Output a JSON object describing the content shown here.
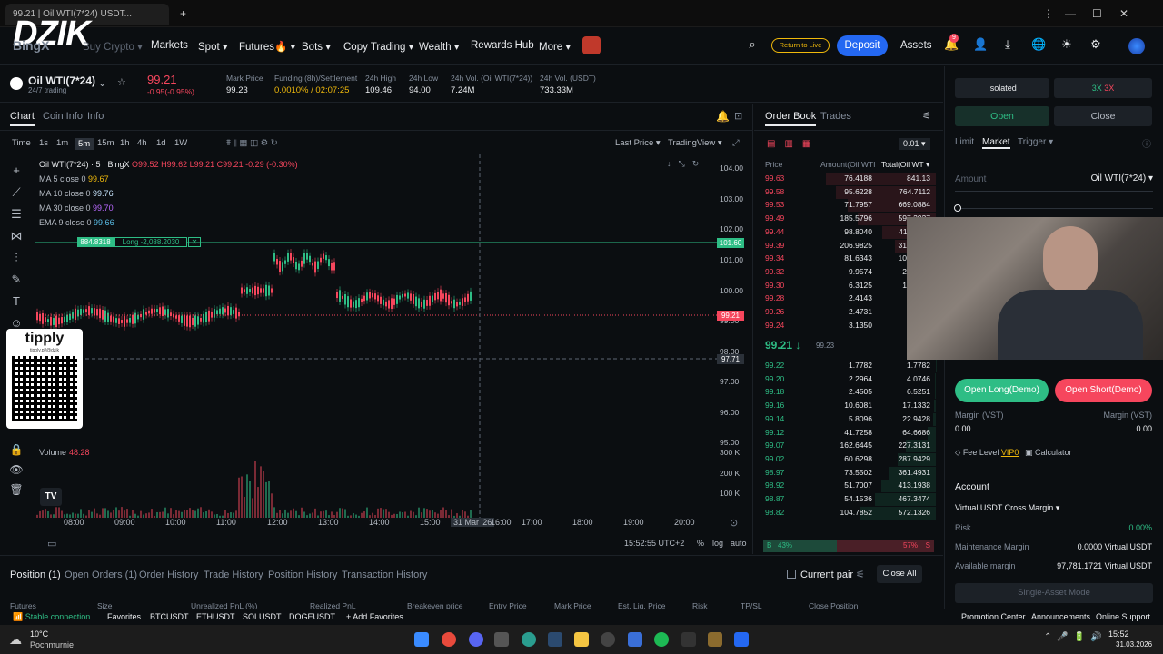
{
  "browser": {
    "tab_title": "99.21 | Oil WTI(7*24) USDT...",
    "new_tab": "+",
    "menu": "⋮",
    "minimize": "—",
    "maximize": "☐",
    "close": "✕"
  },
  "nav": {
    "logo": "DZIK",
    "logo_sub": "BingX",
    "items": [
      "Buy Crypto ▾",
      "Markets",
      "Spot ▾",
      "Futures🔥 ▾",
      "Bots ▾",
      "Copy Trading ▾",
      "Wealth ▾",
      "Rewards Hub",
      "More ▾"
    ],
    "return_live": "Return to Live",
    "deposit": "Deposit",
    "assets": "Assets",
    "notif_count": "9"
  },
  "ticker": {
    "symbol": "Oil WTI(7*24)",
    "sub": "24/7 trading",
    "price": "99.21",
    "change": "-0.95(-0.95%)",
    "stats": [
      {
        "label": "Mark Price",
        "value": "99.23"
      },
      {
        "label": "Funding (8h)/Settlement",
        "value": "0.0010% / 02:07:25"
      },
      {
        "label": "24h High",
        "value": "109.46"
      },
      {
        "label": "24h Low",
        "value": "94.00"
      },
      {
        "label": "24h Vol. (Oil WTI(7*24))",
        "value": "7.24M"
      },
      {
        "label": "24h Vol. (USDT)",
        "value": "733.33M"
      }
    ]
  },
  "chart": {
    "tabs": [
      "Chart",
      "Coin Info",
      "Info"
    ],
    "timeframes": [
      "Time",
      "1s",
      "1m",
      "5m",
      "15m",
      "1h",
      "4h",
      "1d",
      "1W"
    ],
    "price_mode": "Last Price ▾",
    "view_mode": "TradingView ▾",
    "legend_title": "Oil WTI(7*24) · 5 · BingX",
    "legend_ohlc": "O99.52 H99.62 L99.21 C99.21 -0.29 (-0.30%)",
    "ma": [
      {
        "name": "MA 5 close 0",
        "value": "99.67",
        "color": "#f0b90b"
      },
      {
        "name": "MA 10 close 0",
        "value": "99.76",
        "color": "#c8e6ff"
      },
      {
        "name": "MA 30 close 0",
        "value": "99.70",
        "color": "#b968ff"
      },
      {
        "name": "EMA 9 close 0",
        "value": "99.66",
        "color": "#5bc0eb"
      }
    ],
    "position_tag_price": "884.8318",
    "position_tag_label": "Long -2,088.2030",
    "y_ticks": [
      "104.00",
      "103.00",
      "102.00",
      "101.00",
      "100.00",
      "99.00",
      "98.00",
      "97.00",
      "96.00",
      "95.00"
    ],
    "price_tag": "99.21",
    "entry_tag": "101.60",
    "cursor_tag": "97.71",
    "volume_label": "Volume",
    "volume_value": "48.28",
    "vol_ticks": [
      "300 K",
      "200 K",
      "100 K"
    ],
    "x_ticks": [
      "08:00",
      "09:00",
      "10:00",
      "11:00",
      "12:00",
      "13:00",
      "14:00",
      "15:00",
      "31 Mar '26",
      "16:00",
      "17:00",
      "18:00",
      "19:00",
      "20:00"
    ],
    "clock": "15:52:55 UTC+2",
    "pct": "%",
    "log": "log",
    "auto": "auto",
    "tippy_label": "tipply",
    "tippy_url": "tipply.pl/@dzik"
  },
  "orderbook": {
    "tabs": [
      "Order Book",
      "Trades"
    ],
    "precision": "0.01 ▾",
    "headers": [
      "Price",
      "Amount(Oil WTI",
      "Total(Oil WT ▾"
    ],
    "asks": [
      [
        "99.63",
        "76.4188",
        "841.13"
      ],
      [
        "99.58",
        "95.6228",
        "764.7112"
      ],
      [
        "99.53",
        "71.7957",
        "669.0884"
      ],
      [
        "99.49",
        "185.5796",
        "597.2927"
      ],
      [
        "99.44",
        "98.8040",
        "411.7131"
      ],
      [
        "99.39",
        "206.9825",
        "312.9091"
      ],
      [
        "99.34",
        "81.6343",
        "105.9266"
      ],
      [
        "99.32",
        "9.9574",
        "24.2923"
      ],
      [
        "99.30",
        "6.3125",
        "14.3349"
      ],
      [
        "99.28",
        "2.4143",
        "8.0224"
      ],
      [
        "99.26",
        "2.4731",
        "5.6081"
      ],
      [
        "99.24",
        "3.1350",
        "3.1350"
      ]
    ],
    "mid_price": "99.21 ↓",
    "mid_mark": "99.23",
    "bids": [
      [
        "99.22",
        "1.7782",
        "1.7782"
      ],
      [
        "99.20",
        "2.2964",
        "4.0746"
      ],
      [
        "99.18",
        "2.4505",
        "6.5251"
      ],
      [
        "99.16",
        "10.6081",
        "17.1332"
      ],
      [
        "99.14",
        "5.8096",
        "22.9428"
      ],
      [
        "99.12",
        "41.7258",
        "64.6686"
      ],
      [
        "99.07",
        "162.6445",
        "227.3131"
      ],
      [
        "99.02",
        "60.6298",
        "287.9429"
      ],
      [
        "98.97",
        "73.5502",
        "361.4931"
      ],
      [
        "98.92",
        "51.7007",
        "413.1938"
      ],
      [
        "98.87",
        "54.1536",
        "467.3474"
      ],
      [
        "98.82",
        "104.7852",
        "572.1326"
      ]
    ],
    "buy_pct": "43%",
    "sell_pct": "57%",
    "buy_ratio": 0.43,
    "b": "B",
    "s": "S"
  },
  "trade": {
    "margin_mode": "Isolated",
    "leverage_a": "3X",
    "leverage_b": "3X",
    "open": "Open",
    "close": "Close",
    "order_types": [
      "Limit",
      "Market",
      "Trigger ▾"
    ],
    "amount_placeholder": "Amount",
    "amount_unit": "Oil WTI(7*24) ▾",
    "open_long": "Open Long(Demo)",
    "open_short": "Open Short(Demo)",
    "margin_l": "Margin (VST)",
    "margin_r": "Margin (VST)",
    "margin_l_val": "0.00",
    "margin_r_val": "0.00",
    "fee_level": "Fee Level",
    "vip": "VIP0",
    "calculator": "Calculator",
    "account": "Account",
    "account_type": "Virtual USDT Cross Margin ▾",
    "risk_label": "Risk",
    "risk_val": "0.00%",
    "maint_label": "Maintenance Margin",
    "maint_val": "0.0000 Virtual USDT",
    "avail_label": "Available margin",
    "avail_val": "97,781.1721 Virtual USDT",
    "single_asset": "Single-Asset Mode"
  },
  "positions": {
    "tabs": [
      "Position (1)",
      "Open Orders (1)",
      "Order History",
      "Trade History",
      "Position History",
      "Transaction History"
    ],
    "current_pair": "Current pair",
    "close_all": "Close All",
    "cols": [
      "Futures",
      "Size",
      "Unrealized PnL (%)",
      "Realized PnL",
      "Breakeven price",
      "Entry Price",
      "Mark Price",
      "Est. Liq. Price",
      "Risk",
      "TP/SL",
      "Close Position"
    ]
  },
  "statusbar": {
    "connection": "Stable connection",
    "favorites": "Favorites",
    "pairs": [
      "BTCUSDT",
      "ETHUSDT",
      "SOLUSDT",
      "DOGEUSDT"
    ],
    "add_fav": "Add Favorites",
    "right": [
      "Promotion Center",
      "Announcements",
      "Online Support"
    ]
  },
  "taskbar": {
    "temp": "10°C",
    "weather": "Pochmurnie",
    "time": "15:52",
    "date": "31.03.2026"
  },
  "colors": {
    "green": "#2ebd85",
    "red": "#f6465d",
    "accent": "#2468f2"
  }
}
